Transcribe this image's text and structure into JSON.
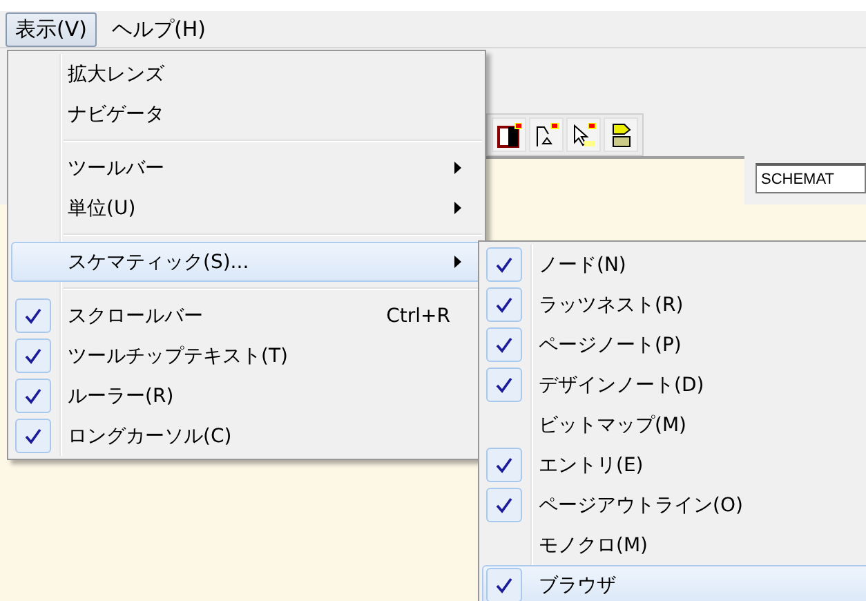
{
  "menubar": [
    {
      "label": "表示(V)",
      "selected": true
    },
    {
      "label": "ヘルプ(H)",
      "selected": false
    }
  ],
  "toolbar": {
    "icons": [
      {
        "kind": "frame"
      },
      {
        "kind": "probe"
      },
      {
        "kind": "pointer"
      },
      {
        "kind": "chip"
      }
    ]
  },
  "schematic_field": {
    "value": "SCHEMAT"
  },
  "view_menu": [
    {
      "kind": "item",
      "label": "拡大レンズ",
      "checked": false,
      "selected": false
    },
    {
      "kind": "item",
      "label": "ナビゲータ",
      "checked": false,
      "selected": false
    },
    {
      "kind": "separator"
    },
    {
      "kind": "submenu",
      "label": "ツールバー",
      "checked": false,
      "selected": false
    },
    {
      "kind": "submenu",
      "label": "単位(U)",
      "checked": false,
      "selected": false
    },
    {
      "kind": "separator"
    },
    {
      "kind": "submenu",
      "label": "スケマティック(S)...",
      "checked": false,
      "selected": true
    },
    {
      "kind": "separator"
    },
    {
      "kind": "item",
      "label": "スクロールバー",
      "shortcut": "Ctrl+R",
      "checked": true,
      "selected": false
    },
    {
      "kind": "item",
      "label": "ツールチップテキスト(T)",
      "checked": true,
      "selected": false
    },
    {
      "kind": "item",
      "label": "ルーラー(R)",
      "checked": true,
      "selected": false
    },
    {
      "kind": "item",
      "label": "ロングカーソル(C)",
      "checked": true,
      "selected": false
    }
  ],
  "schematic_submenu": [
    {
      "label": "ノード(N)",
      "checked": true,
      "selected": false
    },
    {
      "label": "ラッツネスト(R)",
      "checked": true,
      "selected": false
    },
    {
      "label": "ページノート(P)",
      "checked": true,
      "selected": false
    },
    {
      "label": "デザインノート(D)",
      "checked": true,
      "selected": false
    },
    {
      "label": "ビットマップ(M)",
      "checked": false,
      "selected": false
    },
    {
      "label": "エントリ(E)",
      "checked": true,
      "selected": false
    },
    {
      "label": "ページアウトライン(O)",
      "checked": true,
      "selected": false
    },
    {
      "label": "モノクロ(M)",
      "checked": false,
      "selected": false
    },
    {
      "label": "ブラウザ",
      "checked": true,
      "selected": true
    }
  ]
}
